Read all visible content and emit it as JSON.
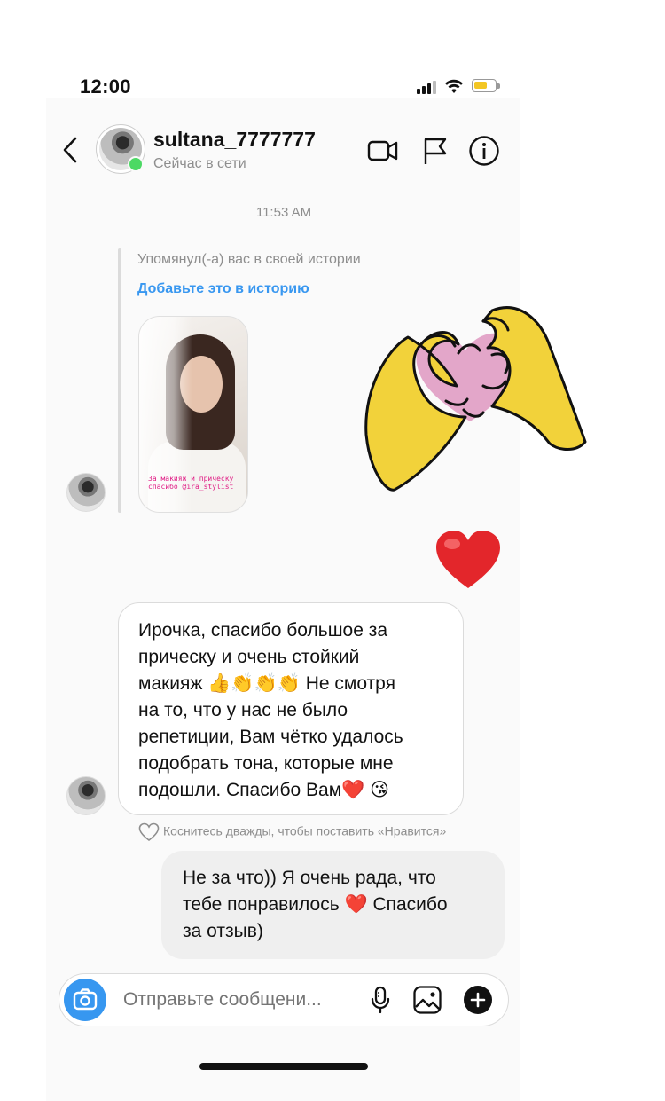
{
  "status_bar": {
    "time": "12:00",
    "battery_color": "#f3c623"
  },
  "header": {
    "username": "sultana_7777777",
    "presence": "Сейчас в сети",
    "icons": [
      "back-chevron-icon",
      "video-call-icon",
      "flag-icon",
      "info-icon"
    ],
    "online_color": "#4cd964"
  },
  "thread": {
    "timestamp": "11:53 AM",
    "story_mention": {
      "text": "Упомянул(-а) вас в своей истории",
      "link": "Добавьте это в историю",
      "caption": "За макияж и прическу спасибо @ira_stylist"
    },
    "sticker": "heart-hands-sticker",
    "emoji_reply": "heart-emoji",
    "incoming_message": {
      "lines": [
        "Ирочка, спасибо большое за",
        "прическу и очень стойкий",
        "макияж 👍👏👏👏 Не смотря",
        "на то, что у нас не было",
        "репетиции, Вам чётко удалось",
        "подобрать тона, которые мне",
        "подошли. Спасибо Вам❤️ 😘"
      ]
    },
    "like_hint": "Коснитесь дважды, чтобы поставить «Нравится»",
    "outgoing_message": {
      "lines": [
        "Не за что)) Я очень рада, что",
        "тебе понравилось ❤️ Спасибо",
        "за отзыв)"
      ]
    }
  },
  "composer": {
    "placeholder": "Отправьте сообщени...",
    "icons": [
      "camera-icon",
      "microphone-icon",
      "gallery-icon",
      "plus-icon"
    ],
    "accent": "#3797f0"
  }
}
